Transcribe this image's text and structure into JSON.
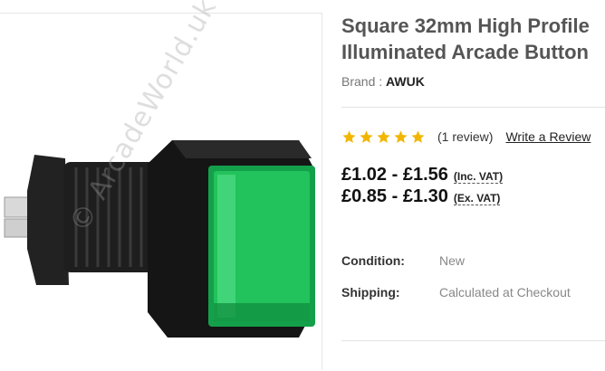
{
  "product": {
    "title_line1": "Square 32mm High Profile",
    "title_line2": "Illuminated Arcade Button",
    "brand_label": "Brand :",
    "brand_value": "AWUK",
    "image_watermark": "© ArcadeWorld.uk"
  },
  "rating": {
    "stars": 5,
    "star_color": "#f2b600",
    "review_count": "(1 review)",
    "write_review": "Write a Review"
  },
  "pricing": {
    "inc_vat_range": "£1.02 - £1.56",
    "inc_vat_label": "(Inc. VAT)",
    "ex_vat_range": "£0.85 - £1.30",
    "ex_vat_label": "(Ex. VAT)"
  },
  "details": {
    "condition_label": "Condition:",
    "condition_value": "New",
    "shipping_label": "Shipping:",
    "shipping_value": "Calculated at Checkout"
  },
  "colors": {
    "button_green": "#1db954",
    "housing_black": "#1a1a1a"
  }
}
